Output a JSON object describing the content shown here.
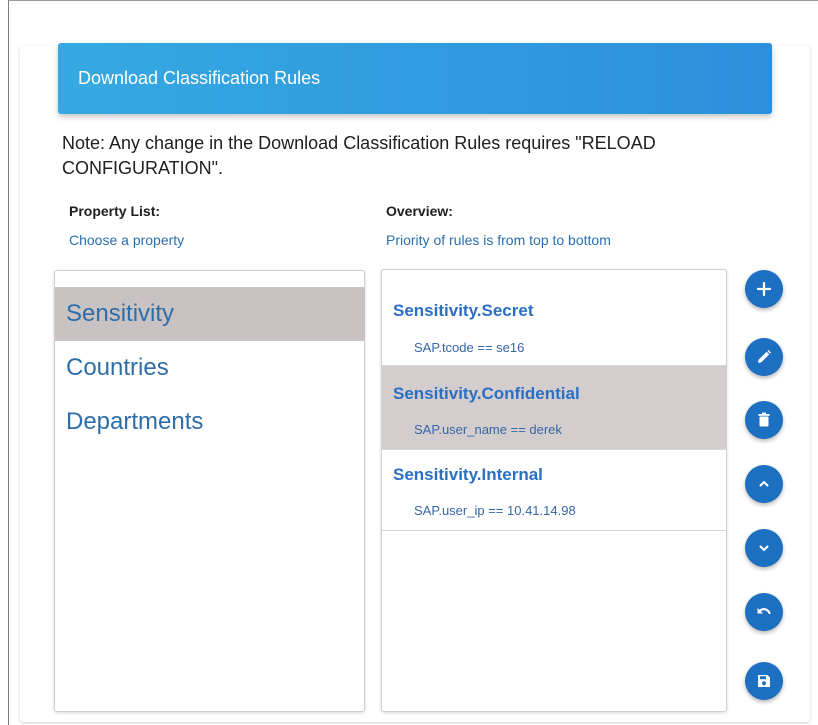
{
  "header": {
    "title": "Download Classification Rules"
  },
  "note": "Note: Any change in the Download Classification Rules requires \"RELOAD CONFIGURATION\".",
  "property_list": {
    "title": "Property List:",
    "subtitle": "Choose a property",
    "items": [
      {
        "label": "Sensitivity",
        "selected": true
      },
      {
        "label": "Countries",
        "selected": false
      },
      {
        "label": "Departments",
        "selected": false
      }
    ]
  },
  "overview": {
    "title": "Overview:",
    "subtitle": "Priority of rules is from top to bottom",
    "rules": [
      {
        "name": "Sensitivity.Secret",
        "condition": "SAP.tcode == se16",
        "selected": false
      },
      {
        "name": "Sensitivity.Confidential",
        "condition": "SAP.user_name == derek",
        "selected": true
      },
      {
        "name": "Sensitivity.Internal",
        "condition": "SAP.user_ip == 10.41.14.98",
        "selected": false
      }
    ]
  },
  "actions": [
    {
      "icon": "plus-icon"
    },
    {
      "icon": "pencil-icon"
    },
    {
      "icon": "trash-icon"
    },
    {
      "icon": "chevron-up-icon"
    },
    {
      "icon": "chevron-down-icon"
    },
    {
      "icon": "undo-icon"
    },
    {
      "icon": "floppy-disk-icon"
    }
  ],
  "colors": {
    "header": "#2b8fdd",
    "accent": "#1d6fc2",
    "link_text": "#2a6fb0",
    "selected_row": "#c9c2c2"
  }
}
